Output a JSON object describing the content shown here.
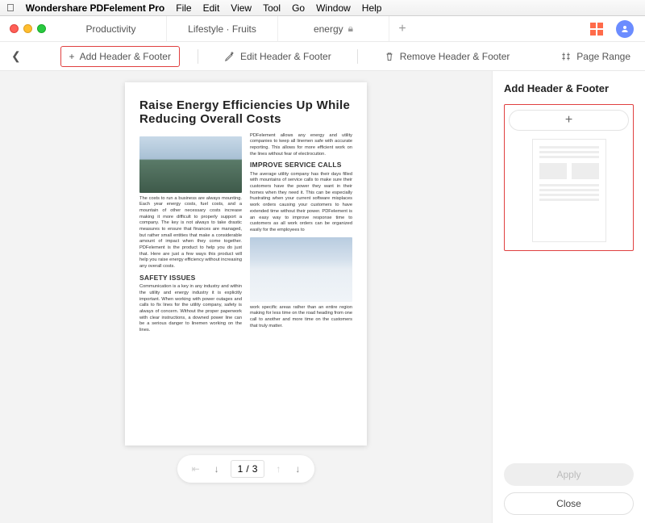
{
  "menubar": {
    "app_name": "Wondershare PDFelement Pro",
    "items": [
      "File",
      "Edit",
      "View",
      "Tool",
      "Go",
      "Window",
      "Help"
    ]
  },
  "tabs": [
    {
      "label": "Productivity",
      "active": false,
      "locked": false
    },
    {
      "label": "Lifestyle · Fruits",
      "active": false,
      "locked": false
    },
    {
      "label": "energy",
      "active": true,
      "locked": true
    }
  ],
  "toolbar": {
    "add_label": "Add Header & Footer",
    "edit_label": "Edit Header & Footer",
    "remove_label": "Remove Header & Footer",
    "page_range_label": "Page Range"
  },
  "pager": {
    "current": "1",
    "sep": "/",
    "total": "3"
  },
  "side": {
    "title": "Add Header & Footer",
    "apply": "Apply",
    "close": "Close"
  },
  "doc": {
    "title": "Raise Energy Efficiencies Up While Reducing Overall Costs",
    "col_left_1": "The costs to run a business are always mounting. Each year energy costs, fuel costs, and a mountain of other necessary costs increase making it more difficult to properly support a company. The key is not always to take drastic measures to ensure that finances are managed, but rather small entities that make a considerable amount of impact when they come together. PDFelement is the product to help you do just that. Here are just a few ways this product will help you raise energy efficiency without increasing any overall costs.",
    "h2_safety": "SAFETY ISSUES",
    "col_left_2": "Communication is a key in any industry and within the utility and energy industry it is explicitly important. When working with power outages and calls to fix lines for the utility company, safety is always of concern. Without the proper paperwork with clear instructions, a downed power line can be a serious danger to linemen working on the lines.",
    "col_right_1": "PDFelement allows any energy and utility companies to keep all linemen safe with accurate reporting. This allows for more efficient work on the lines without fear of electrocution.",
    "h2_service": "IMPROVE SERVICE CALLS",
    "col_right_2": "The average utility company has their days filled with mountains of service calls to make sure their customers have the power they want in their homes when they need it. This can be especially frustrating when your current software misplaces work orders causing your customers to have extended time without their power. PDFelement is an easy way to improve response time to customers as all work orders can be organized easily for the employees to",
    "col_right_3": "work specific areas rather than an entire region making for less time on the road heading from one call to another and more time on the customers that truly matter."
  }
}
